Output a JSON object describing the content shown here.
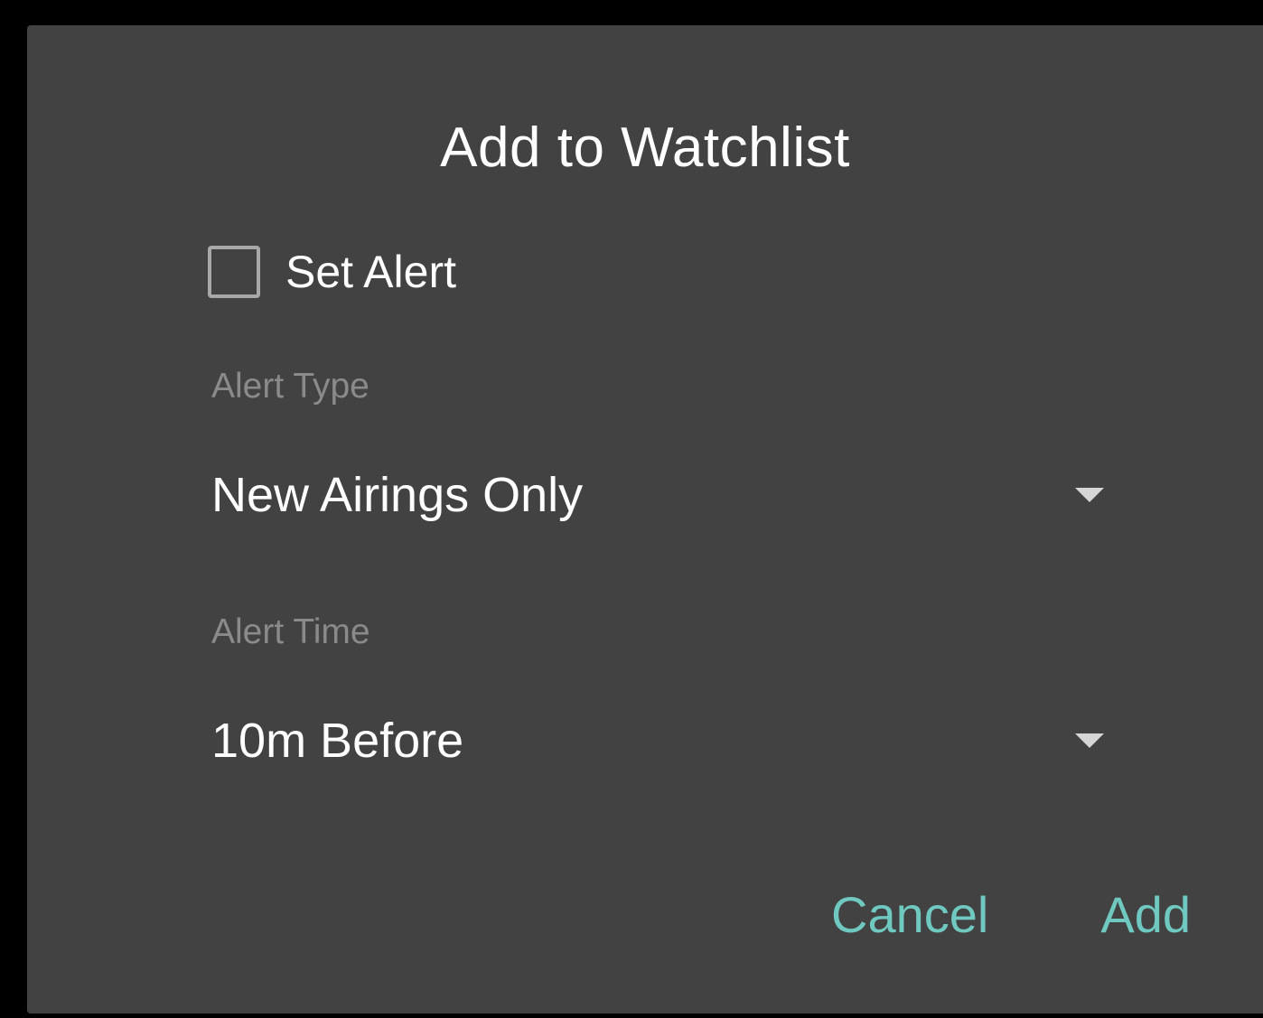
{
  "dialog": {
    "title": "Add to Watchlist",
    "set_alert": {
      "label": "Set Alert",
      "checked": false
    },
    "alert_type": {
      "label": "Alert Type",
      "value": "New Airings Only",
      "icon": "dropdown-arrow-icon"
    },
    "alert_time": {
      "label": "Alert Time",
      "value": "10m Before",
      "icon": "dropdown-arrow-icon"
    },
    "actions": {
      "cancel_label": "Cancel",
      "add_label": "Add"
    }
  },
  "colors": {
    "dialog_background": "#424242",
    "accent": "#6fc9c0",
    "label_muted": "#8a8a8a",
    "text_primary": "#ffffff"
  }
}
